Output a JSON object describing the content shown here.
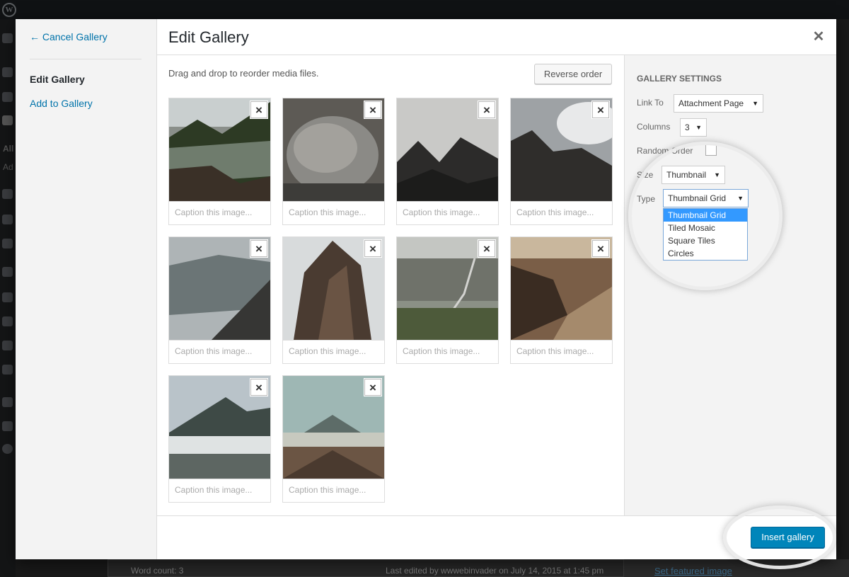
{
  "background": {
    "wp_logo": "wordpress-logo",
    "sidebar_text_1": "All",
    "sidebar_text_2": "Ad",
    "word_count": "Word count: 3",
    "last_edited": "Last edited by wwwebinvader on July 14, 2015 at 1:45 pm",
    "featured_image": "Set featured image"
  },
  "menu": {
    "cancel": "← Cancel Gallery",
    "edit_gallery": "Edit Gallery",
    "add_to_gallery": "Add to Gallery"
  },
  "header": {
    "title": "Edit Gallery",
    "close_icon": "close-icon"
  },
  "content": {
    "hint": "Drag and drop to reorder media files.",
    "reverse_order": "Reverse order",
    "remove_icon": "×",
    "items": [
      {
        "caption_placeholder": "Caption this image..."
      },
      {
        "caption_placeholder": "Caption this image..."
      },
      {
        "caption_placeholder": "Caption this image..."
      },
      {
        "caption_placeholder": "Caption this image..."
      },
      {
        "caption_placeholder": "Caption this image..."
      },
      {
        "caption_placeholder": "Caption this image..."
      },
      {
        "caption_placeholder": "Caption this image..."
      },
      {
        "caption_placeholder": "Caption this image..."
      },
      {
        "caption_placeholder": "Caption this image..."
      },
      {
        "caption_placeholder": "Caption this image..."
      }
    ]
  },
  "settings": {
    "heading": "GALLERY SETTINGS",
    "link_to_label": "Link To",
    "link_to_value": "Attachment Page",
    "columns_label": "Columns",
    "columns_value": "3",
    "random_label": "Random Order",
    "random_checked": false,
    "size_label": "Size",
    "size_value": "Thumbnail",
    "type_label": "Type",
    "type_value": "Thumbnail Grid",
    "type_options": [
      "Thumbnail Grid",
      "Tiled Mosaic",
      "Square Tiles",
      "Circles"
    ],
    "arrow": "▼"
  },
  "footer": {
    "insert": "Insert gallery"
  },
  "colors": {
    "accent": "#0073aa",
    "button_primary": "#0085ba",
    "dropdown_highlight": "#3399ff"
  }
}
